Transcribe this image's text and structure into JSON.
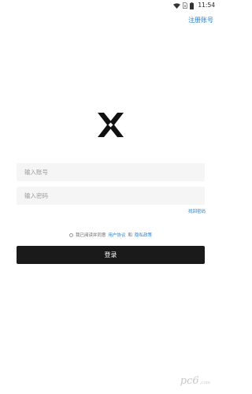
{
  "status_bar": {
    "time": "11:54",
    "icons": [
      "wifi-icon",
      "no-sim-icon",
      "battery-icon"
    ]
  },
  "header": {
    "register_label": "注册账号"
  },
  "logo": {
    "icon": "x-logo-icon",
    "color": "#111111"
  },
  "form": {
    "account_placeholder": "输入账号",
    "password_placeholder": "输入密码",
    "forgot_label": "找回密码"
  },
  "agreement": {
    "prefix": "我已阅读并同意",
    "user_agreement": "用户协议",
    "conjunction": "和",
    "privacy_policy": "隐私政策"
  },
  "login": {
    "label": "登录"
  },
  "watermark": {
    "main": "pc6",
    "sub": ".com"
  },
  "colors": {
    "link": "#1e7fd8",
    "button_bg": "#1a1a1a",
    "input_bg": "#f5f5f5"
  }
}
